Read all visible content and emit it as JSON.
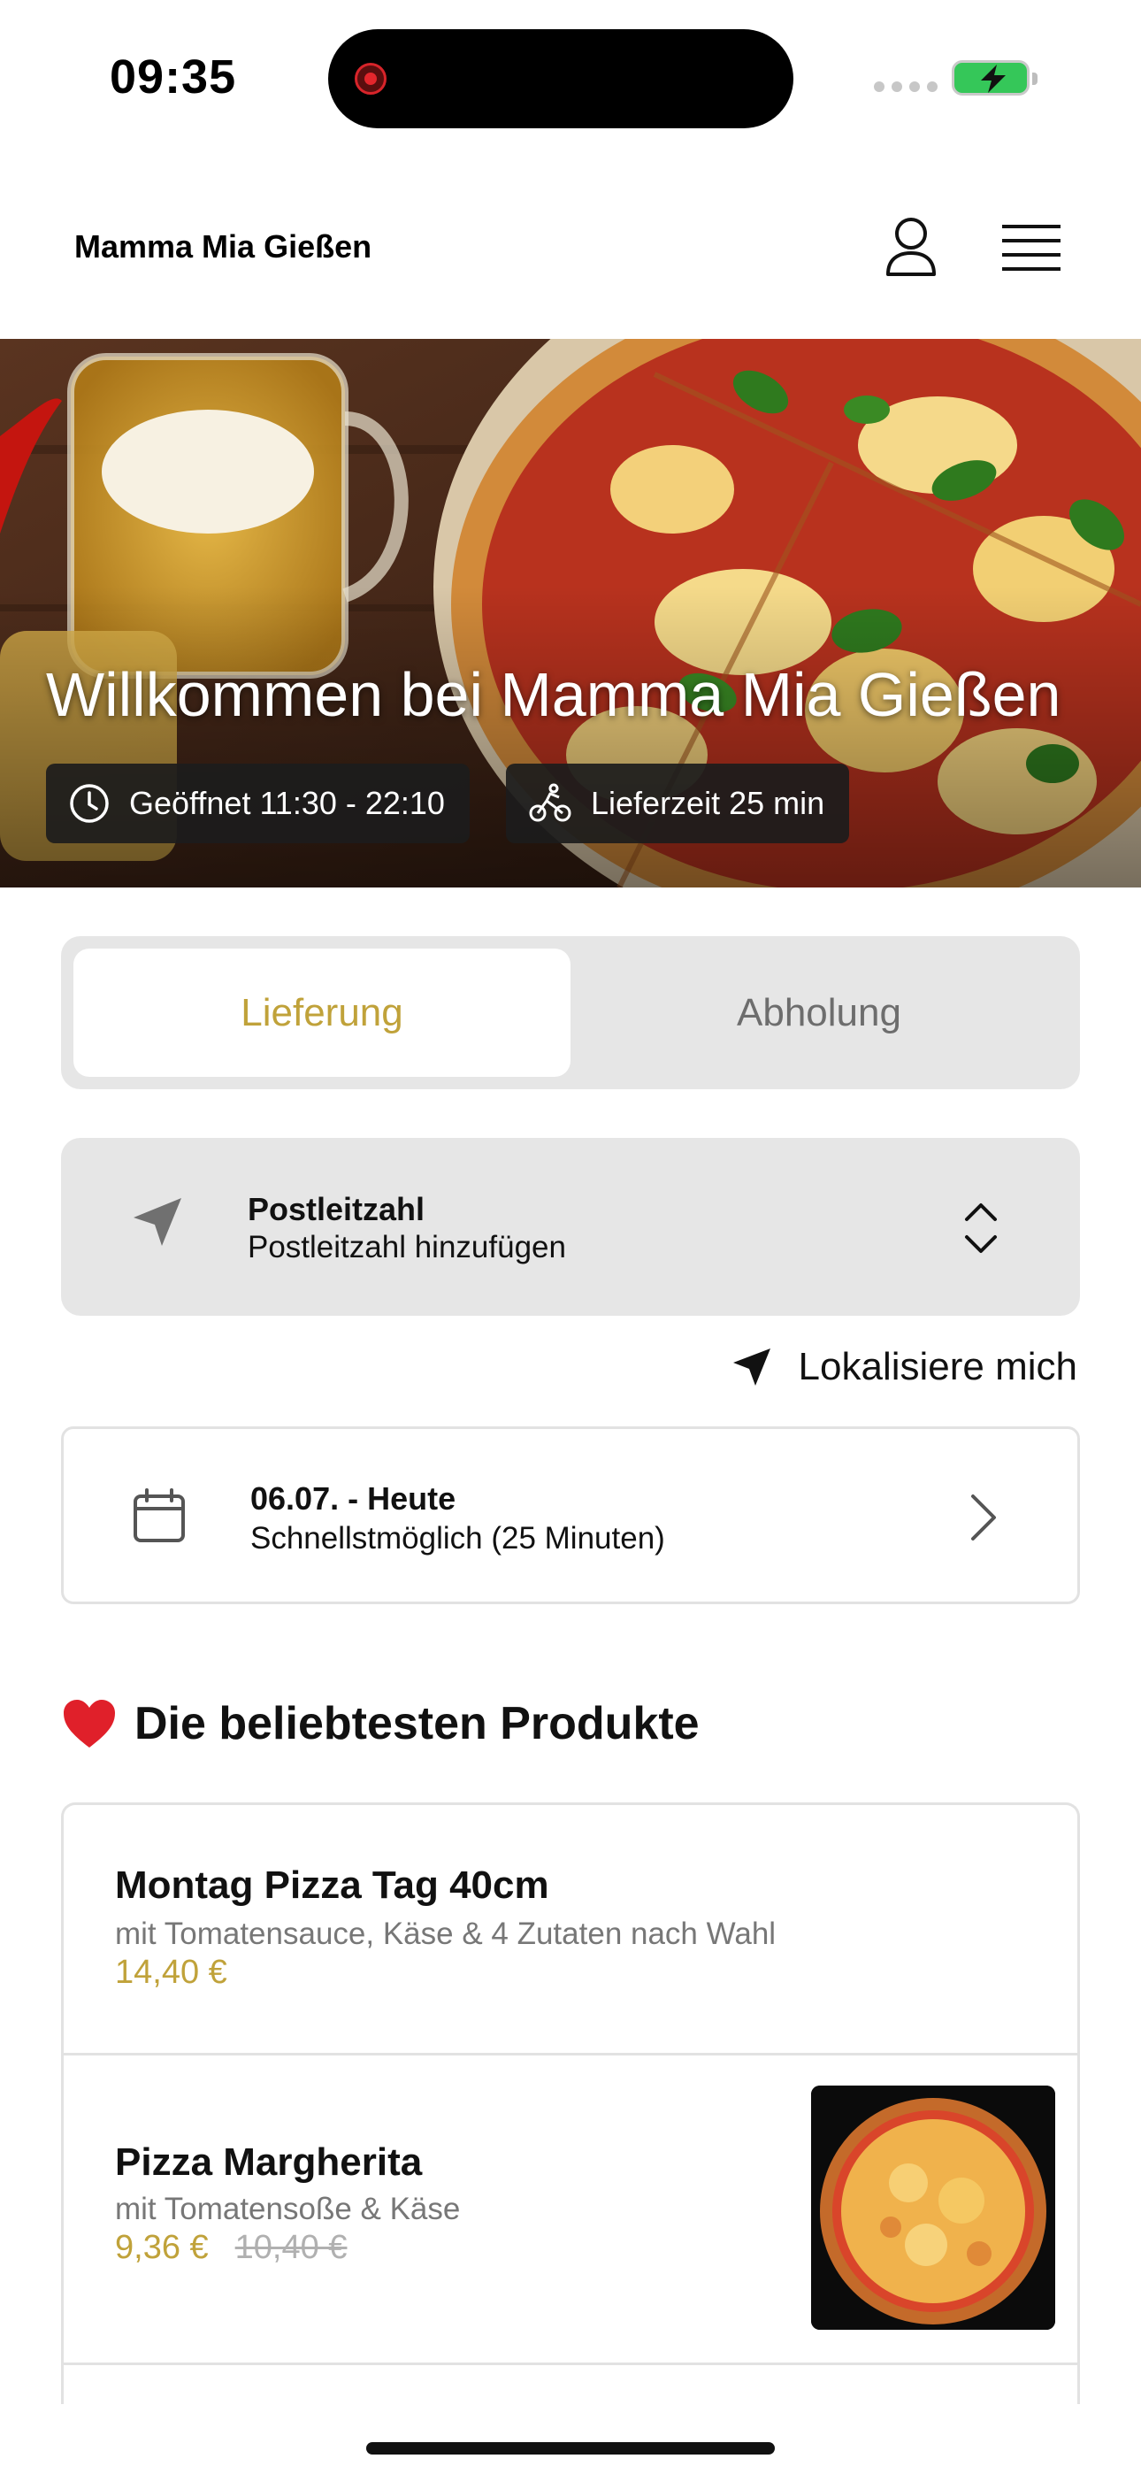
{
  "status_bar": {
    "time": "09:35"
  },
  "header": {
    "brand": "Mamma Mia Gießen",
    "account_icon": "person-icon",
    "menu_icon": "hamburger-menu-icon"
  },
  "hero": {
    "title": "Willkommen bei Mamma Mia Gießen",
    "open_hours": "Geöffnet 11:30 - 22:10",
    "delivery_time": "Lieferzeit 25 min"
  },
  "order_mode": {
    "options": [
      "Lieferung",
      "Abholung"
    ],
    "selected": "Lieferung"
  },
  "postcode": {
    "label": "Postleitzahl",
    "placeholder": "Postleitzahl hinzufügen"
  },
  "locate": {
    "label": "Lokalisiere mich"
  },
  "schedule": {
    "date": "06.07. - Heute",
    "time": "Schnellstmöglich (25 Minuten)"
  },
  "popular": {
    "title": "Die beliebtesten Produkte",
    "products": [
      {
        "name": "Montag Pizza Tag 40cm",
        "description": "mit Tomatensauce, Käse & 4 Zutaten nach Wahl",
        "price": "14,40 €",
        "old_price": ""
      },
      {
        "name": "Pizza Margherita",
        "description": "mit Tomatensoße & Käse",
        "price": "9,36 €",
        "old_price": "10,40 €"
      }
    ]
  },
  "colors": {
    "accent": "#c0a23a",
    "chip_bg": "#1c1c1c",
    "card_bg": "#e6e6e6",
    "battery": "#35c759"
  }
}
